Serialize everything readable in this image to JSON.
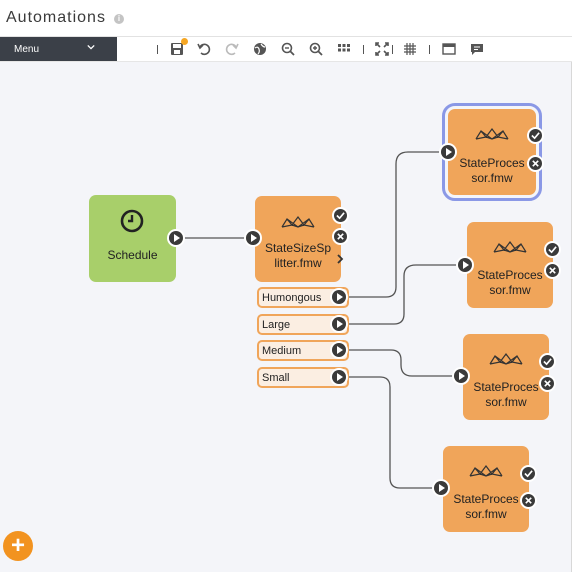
{
  "app": {
    "title": "Automations"
  },
  "toolbar": {
    "menu_label": "Menu",
    "tools": [
      "save-icon",
      "undo-icon",
      "redo-icon",
      "globe-icon",
      "zoom-out-icon",
      "zoom-in-icon",
      "grid-icon",
      "fit-screen-icon",
      "snap-grid-icon",
      "window-icon",
      "comment-icon"
    ]
  },
  "nodes": {
    "schedule": {
      "label": "Schedule",
      "icon": "clock-icon",
      "color": "#a8cf6a"
    },
    "splitter": {
      "label_line1": "StateSizeSp",
      "label_line2": "litter.fmw",
      "color": "#f0a55a",
      "ports": [
        "Humongous",
        "Large",
        "Medium",
        "Small"
      ]
    },
    "processors": [
      {
        "label_line1": "StateProces",
        "label_line2": "sor.fmw",
        "selected": true
      },
      {
        "label_line1": "StateProces",
        "label_line2": "sor.fmw",
        "selected": false
      },
      {
        "label_line1": "StateProces",
        "label_line2": "sor.fmw",
        "selected": false
      },
      {
        "label_line1": "StateProces",
        "label_line2": "sor.fmw",
        "selected": false
      }
    ]
  },
  "colors": {
    "workspace": "#f0a55a",
    "schedule": "#a8cf6a",
    "selection": "#8a98e6",
    "add_button": "#f29320",
    "menu_bg": "#3b4048"
  }
}
